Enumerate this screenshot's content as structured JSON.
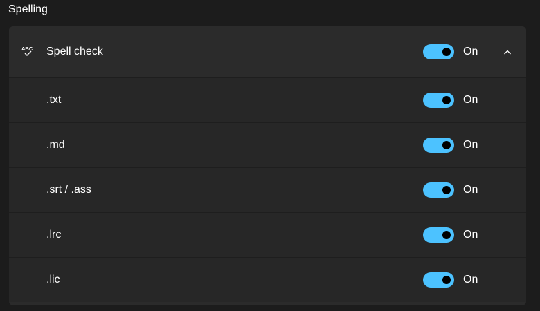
{
  "section": {
    "title": "Spelling"
  },
  "spell_check": {
    "label": "Spell check",
    "state": "On",
    "toggle_on": true,
    "icon": "spell-check-icon",
    "expanded": true
  },
  "file_types": [
    {
      "label": ".txt",
      "state": "On",
      "toggle_on": true
    },
    {
      "label": ".md",
      "state": "On",
      "toggle_on": true
    },
    {
      "label": ".srt / .ass",
      "state": "On",
      "toggle_on": true
    },
    {
      "label": ".lrc",
      "state": "On",
      "toggle_on": true
    },
    {
      "label": ".lic",
      "state": "On",
      "toggle_on": true
    }
  ],
  "colors": {
    "accent": "#4cc2ff",
    "background": "#1c1c1c",
    "card": "#2b2b2b"
  }
}
